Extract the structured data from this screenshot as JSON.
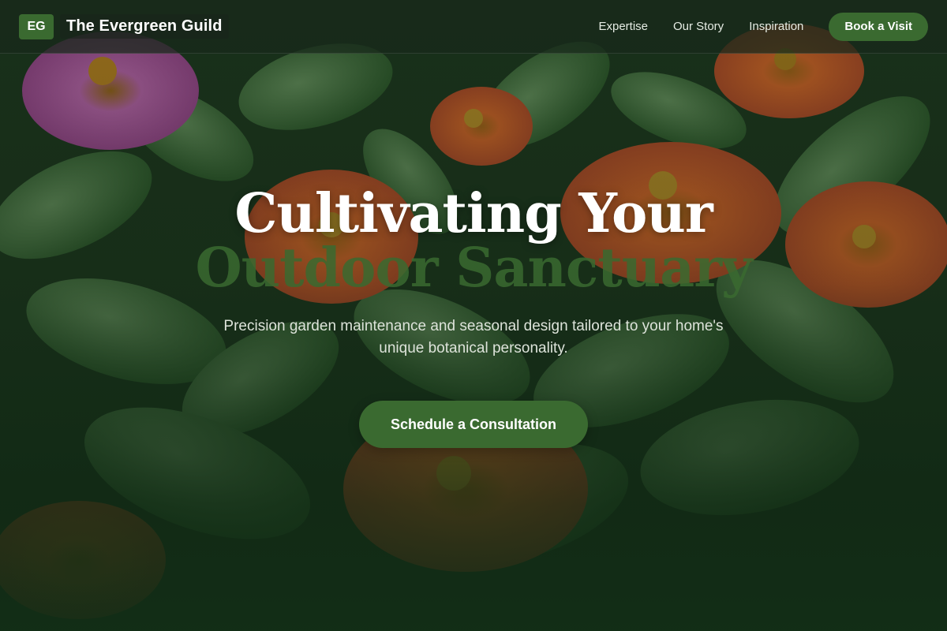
{
  "header": {
    "logo_text": "EG",
    "brand_name": "The Evergreen Guild",
    "nav": [
      {
        "label": "Expertise"
      },
      {
        "label": "Our Story"
      },
      {
        "label": "Inspiration"
      }
    ],
    "cta_label": "Book a Visit"
  },
  "hero": {
    "title_line1": "Cultivating Your",
    "title_line2": "Outdoor Sanctuary",
    "subtitle": "Precision garden maintenance and seasonal design tailored to your home's unique botanical personality.",
    "button_label": "Schedule a Consultation",
    "background_image": "zinnia-flower-garden"
  },
  "colors": {
    "brand_green": "#3a6a30",
    "header_bg": "#18281a",
    "text_light": "#ffffff"
  }
}
